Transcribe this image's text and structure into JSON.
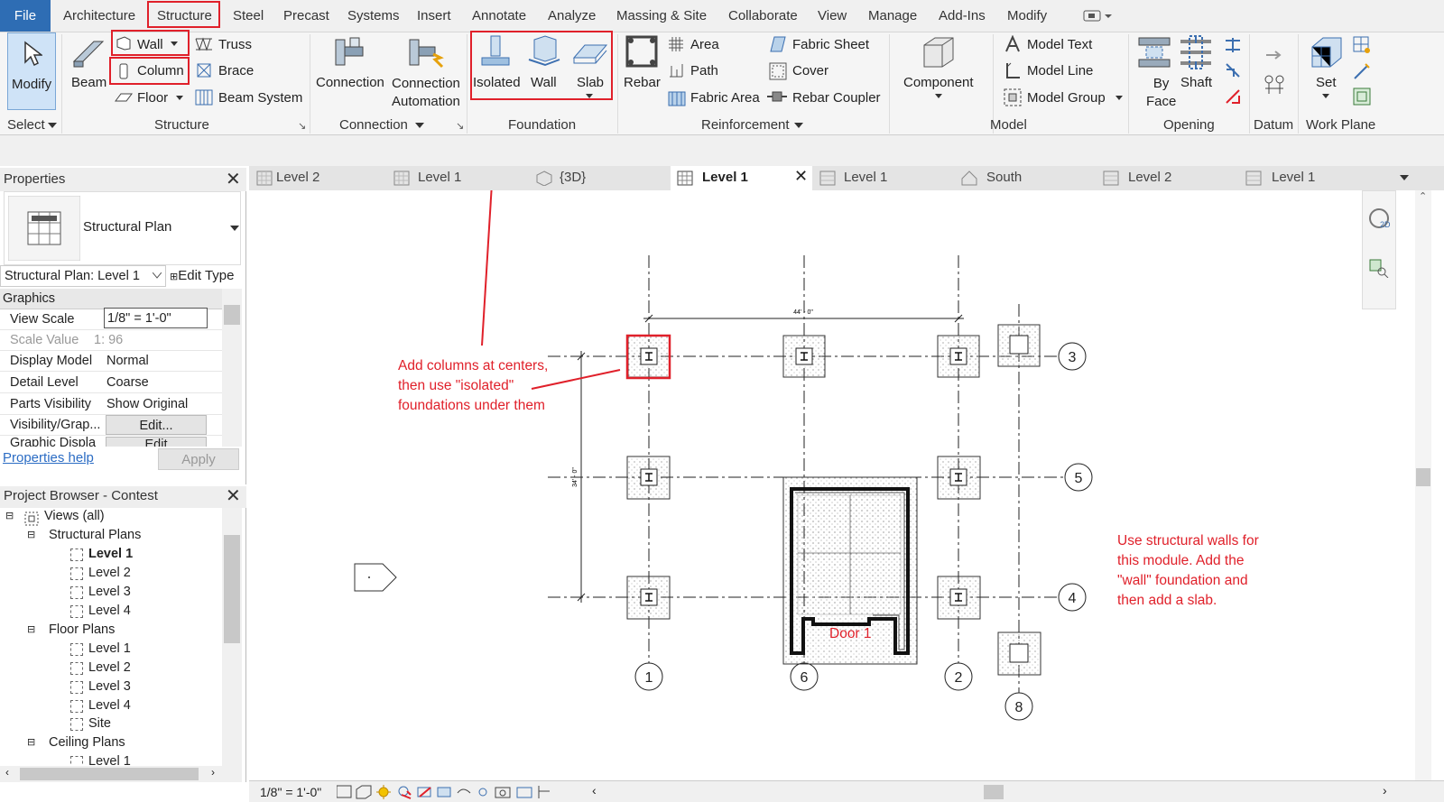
{
  "menu": {
    "file": "File",
    "items": [
      "Architecture",
      "Structure",
      "Steel",
      "Precast",
      "Systems",
      "Insert",
      "Annotate",
      "Analyze",
      "Massing & Site",
      "Collaborate",
      "View",
      "Manage",
      "Add-Ins",
      "Modify"
    ]
  },
  "ribbon": {
    "modify": "Modify",
    "select": "Select",
    "beam": "Beam",
    "wall": "Wall",
    "column": "Column",
    "floor": "Floor",
    "truss": "Truss",
    "brace": "Brace",
    "beam_system": "Beam  System",
    "structure_panel": "Structure",
    "connection": "Connection",
    "connection_automation": "Connection\nAutomation",
    "connection_panel": "Connection",
    "isolated": "Isolated",
    "wall_foundation": "Wall",
    "slab": "Slab",
    "foundation_panel": "Foundation",
    "rebar": "Rebar",
    "area": "Area",
    "path": "Path",
    "fabric_area": "Fabric  Area",
    "fabric_sheet": "Fabric  Sheet",
    "cover": "Cover",
    "rebar_coupler": "Rebar  Coupler",
    "reinforcement_panel": "Reinforcement",
    "component": "Component",
    "model_text": "Model  Text",
    "model_line": "Model  Line",
    "model_group": "Model  Group",
    "model_panel": "Model",
    "by_face": "By\nFace",
    "shaft": "Shaft",
    "opening_panel": "Opening",
    "datum_panel": "Datum",
    "set": "Set",
    "work_plane_panel": "Work Plane"
  },
  "properties": {
    "title": "Properties",
    "type_name": "Structural Plan",
    "selector": "Structural Plan: Level 1",
    "edit_type": "Edit Type",
    "section": "Graphics",
    "rows": [
      {
        "k": "View Scale",
        "v": "1/8\" = 1'-0\""
      },
      {
        "k": "Scale Value",
        "v": "1: 96"
      },
      {
        "k": "Display Model",
        "v": "Normal"
      },
      {
        "k": "Detail Level",
        "v": "Coarse"
      },
      {
        "k": "Parts Visibility",
        "v": "Show Original"
      },
      {
        "k": "Visibility/Grap...",
        "v": "Edit..."
      },
      {
        "k": "Graphic Displa",
        "v": "Edit"
      }
    ],
    "help": "Properties help",
    "apply": "Apply"
  },
  "browser": {
    "title": "Project Browser - Contest",
    "views": "Views (all)",
    "structural": "Structural Plans",
    "sp": [
      "Level 1",
      "Level 2",
      "Level 3",
      "Level 4"
    ],
    "floor": "Floor Plans",
    "fp": [
      "Level 1",
      "Level 2",
      "Level 3",
      "Level 4",
      "Site"
    ],
    "ceiling": "Ceiling Plans",
    "cp": [
      "Level 1"
    ]
  },
  "tabs": [
    "Level 2",
    "Level 1",
    "{3D}",
    "Level 1",
    "Level 1",
    "South",
    "Level 2",
    "Level 1"
  ],
  "canvas": {
    "grids": [
      "1",
      "6",
      "2",
      "8",
      "3",
      "5",
      "4"
    ],
    "dim_h": "44' - 0\"",
    "dim_v": "34' - 0\"",
    "door": "Door 1"
  },
  "annotations": {
    "a1": [
      "Add columns at centers,",
      "then use \"isolated\"",
      "foundations under them"
    ],
    "a2": [
      "Use structural walls for",
      "this module. Add the",
      "\"wall\" foundation and",
      "then add a slab."
    ]
  },
  "status": {
    "scale": "1/8\" = 1'-0\""
  },
  "colors": {
    "accent": "#2e6db4",
    "highlight": "#e0202a"
  }
}
